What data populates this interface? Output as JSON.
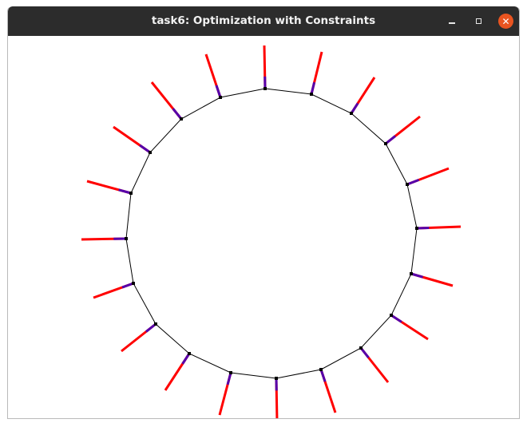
{
  "window": {
    "title": "task6: Optimization with Constraints",
    "controls": {
      "minimize_icon": "minimize-icon",
      "maximize_icon": "maximize-icon",
      "close_icon": "close-icon",
      "close_glyph": "✕"
    },
    "colors": {
      "titlebar": "#2c2c2c",
      "close_button": "#e95420",
      "background": "#ffffff"
    }
  },
  "scene": {
    "polygon_color": "#000000",
    "vector_outer_color": "#ff0000",
    "vector_inner_color": "#5500aa",
    "vertex_count": 24
  }
}
